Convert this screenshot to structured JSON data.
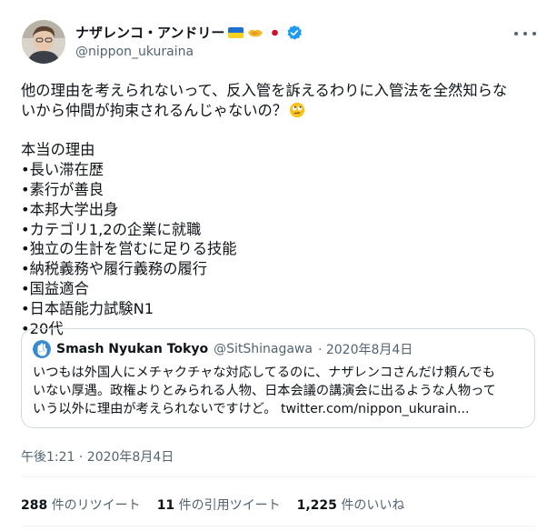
{
  "author": {
    "display_name": "ナザレンコ・アンドリー",
    "handle": "@nippon_ukuraina",
    "icons": [
      "ukraine-flag-icon",
      "handshake-icon",
      "japan-flag-icon",
      "verified-badge-icon"
    ]
  },
  "tweet": {
    "lines": [
      "他の理由を考えられないって、反入管を訴えるわりに入管法を全然知らな",
      "いから仲間が拘束されるんじゃないの？",
      "",
      "本当の理由",
      "•長い滞在歴",
      "•素行が善良",
      "•本邦大学出身",
      "•カテゴリ1,2の企業に就職",
      "•独立の生計を営むに足りる技能",
      "•納税義務や履行義務の履行",
      "•国益適合",
      "•日本語能力試験N1",
      "•20代"
    ],
    "emoji": "rolling-eyes-face-icon"
  },
  "quote": {
    "name": "Smash Nyukan Tokyo",
    "handle": "@SitShinagawa",
    "date": "· 2020年8月4日",
    "lines": [
      "いつもは外国人にメチャクチャな対応してるのに、ナザレンコさんだけ頼んでも",
      "いない厚遇。政権よりとみられる人物、日本会議の講演会に出るような人物って",
      "いう以外に理由が考えられないですけど。 twitter.com/nippon_ukurain..."
    ]
  },
  "timestamp": "午後1:21 · 2020年8月4日",
  "stats": {
    "retweets": {
      "count": "288",
      "label": "件のリツイート"
    },
    "quotes": {
      "count": "11",
      "label": "件の引用ツイート"
    },
    "likes": {
      "count": "1,225",
      "label": "件のいいね"
    }
  },
  "colors": {
    "text": "#0f1419",
    "secondary": "#536471",
    "border": "#cfd9de",
    "verified": "#1d9bf0"
  }
}
